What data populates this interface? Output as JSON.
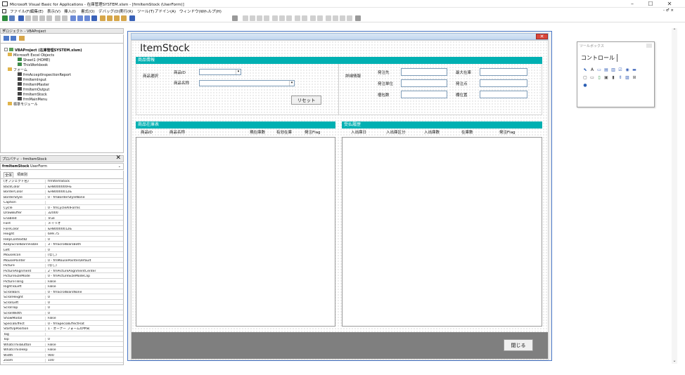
{
  "window": {
    "title": "Microsoft Visual Basic for Applications - 在庫管理SYSTEM.xlsm - [frmItemStock (UserForm)]",
    "minimize": "–",
    "maximize": "☐",
    "close": "✕",
    "inner_restore": "- ♂ ×"
  },
  "menu": [
    "ファイル(F)",
    "編集(E)",
    "表示(V)",
    "挿入(I)",
    "書式(O)",
    "デバッグ(D)",
    "実行(R)",
    "ツール(T)",
    "アドイン(A)",
    "ウィンドウ(W)",
    "ヘルプ(H)"
  ],
  "project_pane": {
    "title": "プロジェクト - VBAProject",
    "close": "✕",
    "tree": [
      {
        "label": "VBAProject (在庫管理SYSTEM.xlsm)",
        "level": 0,
        "bold": true
      },
      {
        "label": "Microsoft Excel Objects",
        "level": 1
      },
      {
        "label": "Sheet1 (HOME)",
        "level": 2
      },
      {
        "label": "ThisWorkbook",
        "level": 2
      },
      {
        "label": "フォーム",
        "level": 1
      },
      {
        "label": "frmAcceptInspectionReport",
        "level": 2
      },
      {
        "label": "frmItemInput",
        "level": 2
      },
      {
        "label": "frmItemMaster",
        "level": 2
      },
      {
        "label": "frmItemOutput",
        "level": 2
      },
      {
        "label": "frmItemStock",
        "level": 2
      },
      {
        "label": "frmMainMenu",
        "level": 2
      },
      {
        "label": "標準モジュール",
        "level": 1
      }
    ]
  },
  "properties_pane": {
    "title": "プロパティ - frmItemStock",
    "close": "✕",
    "object_name": "frmItemStock",
    "object_type": "UserForm",
    "tabs": [
      "全体",
      "項目別"
    ],
    "rows": [
      [
        "(オブジェクト名)",
        "frmItemStock"
      ],
      [
        "BackColor",
        "&H8000000F&"
      ],
      [
        "BorderColor",
        "&H80000012&"
      ],
      [
        "BorderStyle",
        "0 - fmBorderStyleNone"
      ],
      [
        "Caption",
        ""
      ],
      [
        "Cycle",
        "0 - fmCycleAllForms"
      ],
      [
        "DrawBuffer",
        "32000"
      ],
      [
        "Enabled",
        "True"
      ],
      [
        "Font",
        "メイリオ"
      ],
      [
        "ForeColor",
        "&H80000012&"
      ],
      [
        "Height",
        "699.75"
      ],
      [
        "HelpContextID",
        "0"
      ],
      [
        "KeepScrollBarsVisible",
        "3 - fmScrollBarsBoth"
      ],
      [
        "Left",
        "0"
      ],
      [
        "MouseIcon",
        "(なし)"
      ],
      [
        "MousePointer",
        "0 - fmMousePointerDefault"
      ],
      [
        "Picture",
        "(なし)"
      ],
      [
        "PictureAlignment",
        "2 - fmPictureAlignmentCenter"
      ],
      [
        "PictureSizeMode",
        "0 - fmPictureSizeModeClip"
      ],
      [
        "PictureTiling",
        "False"
      ],
      [
        "RightToLeft",
        "False"
      ],
      [
        "ScrollBars",
        "0 - fmScrollBarsNone"
      ],
      [
        "ScrollHeight",
        "0"
      ],
      [
        "ScrollLeft",
        "0"
      ],
      [
        "ScrollTop",
        "0"
      ],
      [
        "ScrollWidth",
        "0"
      ],
      [
        "ShowModal",
        "False"
      ],
      [
        "SpecialEffect",
        "0 - fmSpecialEffectFlat"
      ],
      [
        "StartUpPosition",
        "1 - オーナー フォームの中央"
      ],
      [
        "Tag",
        ""
      ],
      [
        "Top",
        "0"
      ],
      [
        "WhatsThisButton",
        "False"
      ],
      [
        "WhatsThisHelp",
        "False"
      ],
      [
        "Width",
        "900"
      ],
      [
        "Zoom",
        "100"
      ]
    ]
  },
  "form": {
    "title": "ItemStock",
    "close": "✕",
    "item_info": {
      "header": "商品情報",
      "select_label": "商品選択",
      "id_label": "商品ID",
      "name_label": "商品名称",
      "reset_button": "リセット",
      "details_label": "詳細情報",
      "order_dest_label": "発注先",
      "order_unit_label": "発注単位",
      "storage_label": "梱包数",
      "max_stock_label": "最大在庫",
      "order_point_label": "発注点",
      "location_label": "棚位置"
    },
    "stock": {
      "header": "商品在庫表",
      "columns": [
        "商品ID",
        "商品名称",
        "現在庫数",
        "有効在庫",
        "発注Flag"
      ]
    },
    "history": {
      "header": "受払履歴",
      "columns": [
        "入出庫日",
        "入出庫区分",
        "入出庫数",
        "在庫数",
        "発注Flag"
      ]
    },
    "close_button": "閉じる"
  },
  "toolbox": {
    "title": "ツールボックス",
    "tab": "コントロール",
    "tools": [
      "pointer",
      "label",
      "textbox",
      "combobox",
      "listbox",
      "checkbox",
      "optionbutton",
      "togglebutton",
      "frame",
      "commandbutton",
      "tabstrip",
      "multipage",
      "scrollbar",
      "spinbutton",
      "image",
      "refedit",
      "globe"
    ]
  }
}
